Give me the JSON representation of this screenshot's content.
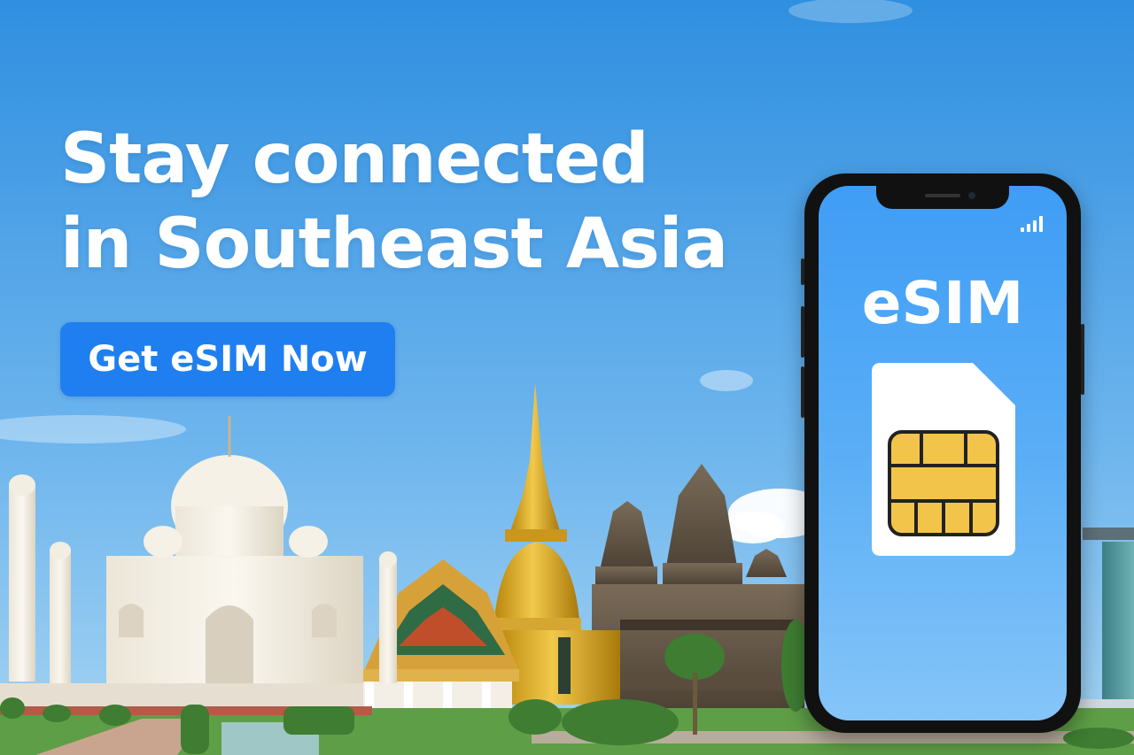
{
  "headline": {
    "line1": "Stay connected",
    "line2": "in Southeast Asia"
  },
  "cta": {
    "label": "Get eSIM Now"
  },
  "phone": {
    "label": "eSIM",
    "status_icon": "signal-bars-icon",
    "sim_icon": "sim-card-icon"
  },
  "colors": {
    "sky_top": "#2f8fe0",
    "sky_bottom": "#9cd0f2",
    "cta": "#1f7ff0",
    "chip": "#f3c44a"
  }
}
